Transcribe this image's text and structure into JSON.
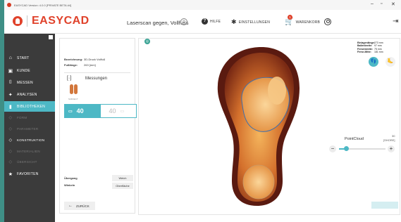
{
  "titlebar": {
    "text": "EASYCAD Version: 4.0.0 [PRIVATE BETA #4]",
    "minimize": "–",
    "maximize": "▫",
    "close": "✕"
  },
  "header": {
    "logo_text": "EASYCAD",
    "document_title": "Laserscan gegen, Vollfuss",
    "nav": [
      {
        "icon": "help-icon",
        "glyph": "?",
        "label": "HILFE"
      },
      {
        "icon": "gear-icon",
        "glyph": "✱",
        "label": "EINSTELLUNGEN"
      },
      {
        "icon": "cart-icon",
        "glyph": "🛒",
        "label": "WARENKORB",
        "badge": "1"
      }
    ]
  },
  "sidebar": {
    "items": [
      {
        "label": "START",
        "icon": "home-icon",
        "glyph": "⌂"
      },
      {
        "label": "KUNDE",
        "icon": "customer-icon",
        "glyph": "▣"
      },
      {
        "label": "MESSEN",
        "icon": "measure-icon",
        "glyph": "⌷"
      },
      {
        "label": "ANALYSEN",
        "icon": "analysis-icon",
        "glyph": "✦"
      },
      {
        "label": "BIBLIOTHEKEN",
        "icon": "library-icon",
        "glyph": "▮",
        "active": true
      },
      {
        "label": "FORM",
        "icon": "form-icon",
        "glyph": "◇",
        "sub": true
      },
      {
        "label": "PARAMETER",
        "icon": "parameter-icon",
        "glyph": "◇",
        "sub": true
      },
      {
        "label": "KONSTRUKTION",
        "icon": "construction-icon",
        "glyph": "◇",
        "sub": true,
        "on": true
      },
      {
        "label": "MATERIALIEN",
        "icon": "materials-icon",
        "glyph": "◇",
        "sub": true
      },
      {
        "label": "ÜBERSICHT",
        "icon": "overview-icon",
        "glyph": "◇",
        "sub": true
      },
      {
        "label": "FAVORITEN",
        "icon": "star-icon",
        "glyph": "★"
      }
    ]
  },
  "panel": {
    "info": [
      {
        "key": "Bezeichnung:",
        "value": "3D-Druck Vollfuß"
      },
      {
        "key": "Fußlänge:",
        "value": "263 [mm]"
      }
    ],
    "measurement_label": "Messungen",
    "measurement_sub": "SUBJECT",
    "size_left": "40",
    "size_right": "40",
    "transitions": [
      {
        "label": "Übergang",
        "button": "Weich"
      },
      {
        "label": "Winkeln",
        "button": "Oberfläche"
      }
    ],
    "back_label": "ZURÜCK"
  },
  "viewer": {
    "badge": "◎",
    "dimensions": [
      {
        "key": "Einlagenlänge:",
        "value": "273 mm"
      },
      {
        "key": "Ballenbreite:",
        "value": "97 mm"
      },
      {
        "key": "Fersenbreite:",
        "value": "75 mm"
      },
      {
        "key": "Ferse-Mitte:",
        "value": "181 mm"
      }
    ],
    "slider_label": "PointCloud",
    "slider_value": "30",
    "slider_unit": "[SHORE]",
    "slider_fraction": 0.15,
    "foot_buttons": [
      "👣",
      "🦶"
    ]
  },
  "colors": {
    "accent": "#4db8c5",
    "brand": "#e0422b",
    "sidebar": "#3b3b3b"
  }
}
